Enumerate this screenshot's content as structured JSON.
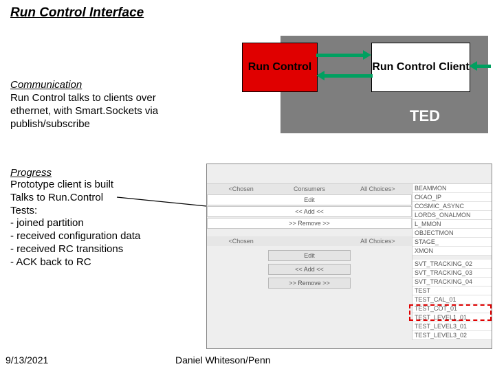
{
  "title": "Run Control Interface",
  "communication": {
    "heading": "Communication",
    "body": "Run Control talks to clients over ethernet, with Smart.Sockets via publish/subscribe"
  },
  "progress": {
    "heading": "Progress",
    "lines": [
      "Prototype client is built",
      "Talks to Run.Control",
      "Tests:",
      " - joined partition",
      " - received configuration data",
      " - received RC transitions",
      " - ACK back to RC"
    ]
  },
  "diagram": {
    "run_control": "Run Control",
    "client": "Run Control Client",
    "ted": "TED"
  },
  "screenshot": {
    "sec1": {
      "chosen": "<Chosen",
      "all": "All Choices>"
    },
    "header1": "Consumers",
    "btns1": {
      "edit": "Edit",
      "add": "<< Add <<",
      "remove": ">> Remove >>"
    },
    "sec2": {
      "chosen": "<Chosen",
      "all": "All Choices>"
    },
    "btns2": {
      "edit": "Edit",
      "add": "<< Add <<",
      "remove": ">> Remove >>"
    },
    "right_list1": [
      "BEAMMON",
      "CKAO_IP",
      "COSMIC_ASYNC",
      "LORDS_ONALMON",
      "L_MMON",
      "OBJECTMON",
      "STAGE_",
      "XMON"
    ],
    "right_list2": [
      "SVT_TRACKING_02",
      "SVT_TRACKING_03",
      "SVT_TRACKING_04",
      "TEST",
      "TEST_CAL_01",
      "TEST_COT_01",
      "TEST_LEVEL1_01",
      "TEST_LEVEL3_01",
      "TEST_LEVEL3_02"
    ]
  },
  "footer": {
    "date": "9/13/2021",
    "author": "Daniel Whiteson/Penn"
  }
}
